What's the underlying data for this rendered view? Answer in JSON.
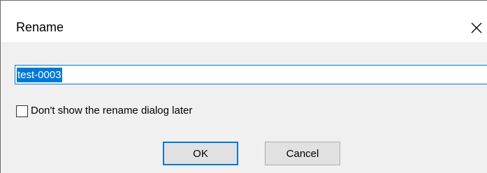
{
  "dialog": {
    "title": "Rename",
    "close_icon": "close-icon"
  },
  "name_input": {
    "value": "test-0003",
    "selected": true
  },
  "dont_show_checkbox": {
    "label": "Don't show the rename dialog later",
    "checked": false
  },
  "buttons": {
    "ok_label": "OK",
    "cancel_label": "Cancel"
  },
  "colors": {
    "accent": "#0078d7",
    "dialog_background": "#f0f0f0",
    "title_bar_background": "#ffffff",
    "button_background": "#e1e1e1"
  }
}
